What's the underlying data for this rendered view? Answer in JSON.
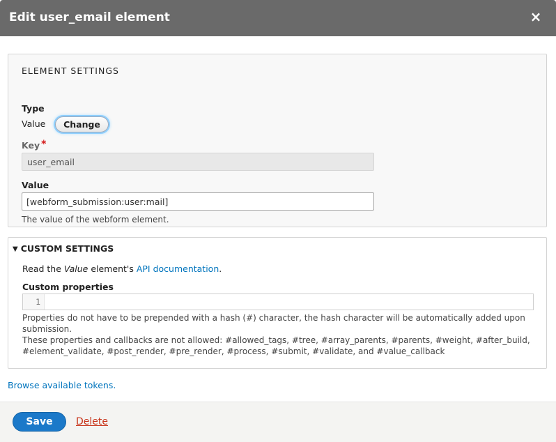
{
  "dialog": {
    "title": "Edit user_email element",
    "close_icon": "×"
  },
  "element_settings": {
    "legend": "ELEMENT SETTINGS",
    "type_label": "Type",
    "type_value": "Value",
    "change_button": "Change",
    "key_label": "Key",
    "key_required_marker": "*",
    "key_value": "user_email",
    "value_label": "Value",
    "value_input": "[webform_submission:user:mail]",
    "value_description": "The value of the webform element."
  },
  "custom_settings": {
    "summary": "CUSTOM SETTINGS",
    "toggle_icon": "▼",
    "read_prefix": "Read the ",
    "read_element": "Value",
    "read_middle": " element's ",
    "api_link": "API documentation",
    "read_suffix": ".",
    "custom_properties_label": "Custom properties",
    "code_line_number": "1",
    "desc_line1": "Properties do not have to be prepended with a hash (#) character, the hash character will be automatically added upon",
    "desc_line2": "submission.",
    "desc_line3": "These properties and callbacks are not allowed: #allowed_tags, #tree, #array_parents, #parents, #weight, #after_build,",
    "desc_line4": "#element_validate, #post_render, #pre_render, #process, #submit, #validate, and #value_callback"
  },
  "browse_tokens_link": "Browse available tokens.",
  "footer": {
    "save_button": "Save",
    "delete_link": "Delete"
  },
  "colors": {
    "titlebar": "#6a6a6a",
    "link": "#0074bd",
    "primary_button": "#1b79c9",
    "delete": "#c8341a",
    "required": "#d41a1a"
  }
}
